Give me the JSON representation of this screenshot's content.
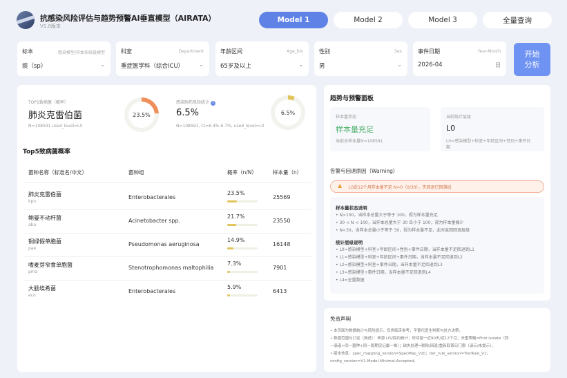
{
  "header": {
    "title": "抗感染风险评估与趋势预警AI垂直模型（AIRATA）",
    "version": "V1.0版本",
    "tabs": [
      {
        "label": "Model 1",
        "active": true
      },
      {
        "label": "Model 2",
        "active": false
      },
      {
        "label": "Model 3",
        "active": false
      },
      {
        "label": "全量查询",
        "active": false
      }
    ]
  },
  "filters": [
    {
      "label": "标本",
      "en": "感染模型/样本系统级模型",
      "value": "痰（sp）",
      "icon": "chevron-down-icon"
    },
    {
      "label": "科室",
      "en": "Department",
      "value": "重症医学科（综合ICU）",
      "icon": "chevron-down-icon"
    },
    {
      "label": "年龄区间",
      "en": "Age_bin",
      "value": "65岁及以上",
      "icon": "chevron-down-icon"
    },
    {
      "label": "性别",
      "en": "Sex",
      "value": "男",
      "icon": "chevron-down-icon"
    },
    {
      "label": "事件日期",
      "en": "Year-Month",
      "value": "2026-04",
      "icon": "calendar-icon"
    }
  ],
  "start_button": {
    "line1": "开始",
    "line2": "分析"
  },
  "left": {
    "top1": {
      "label": "TOP1致病菌（概率）",
      "name": "肺炎克雷伯菌",
      "sub": "N=108591  used_level=L0",
      "ring_value": "23.5%",
      "ring_fraction": 0.235,
      "ring_color": "#ef8f5a"
    },
    "risk": {
      "label": "感染耐药风险统计",
      "value": "6.5%",
      "sub": "N=108591, CI=6.4%-6.7%, used_level=L0",
      "ring_value": "6.5%",
      "ring_fraction": 0.065,
      "ring_color": "#e2c55a"
    },
    "table_title": "Top5致病菌概率",
    "table_headers": [
      "菌种名称（标准名/中文）",
      "菌种组",
      "概率（n/N）",
      "样本量（n）"
    ],
    "rows": [
      {
        "name": "肺炎克雷伯菌",
        "code": "kpn",
        "group": "Enterobacterales",
        "prob": "23.5%",
        "fraction": 0.235,
        "n": "25569"
      },
      {
        "name": "鲍曼不动杆菌",
        "code": "aba",
        "group": "Acinetobacter spp.",
        "prob": "21.7%",
        "fraction": 0.217,
        "n": "23550"
      },
      {
        "name": "铜绿假单胞菌",
        "code": "pae",
        "group": "Pseudomonas aeruginosa",
        "prob": "14.9%",
        "fraction": 0.149,
        "n": "16148"
      },
      {
        "name": "嗜麦芽窄食单胞菌",
        "code": "pma",
        "group": "Stenotrophomonas maltophilia",
        "prob": "7.3%",
        "fraction": 0.073,
        "n": "7901"
      },
      {
        "name": "大肠埃希菌",
        "code": "eco",
        "group": "Enterobacterales",
        "prob": "5.9%",
        "fraction": 0.059,
        "n": "6413"
      }
    ]
  },
  "right": {
    "title": "趋势与预警面板",
    "card1": {
      "label": "样本量状态",
      "value": "样本量充足",
      "sub": "当前总样本量N=108591"
    },
    "card2": {
      "label": "当前统计层级",
      "value": "L0",
      "sub1": "L0=感染模型+科室+年龄区间+性别+事件日",
      "sub2": "期"
    },
    "warning_title": "告警与回退原因（Warning）",
    "warning_text": "L0近12个月样本量不足 N=0（0/30），失回退已回溯线",
    "status_title": "样本量状态说明",
    "status_lines": [
      "• N>100，当样本总量大于等于 100，视为样本量充足",
      "• 30 < N < 100，当样本总量大于 30 且小于 100，视为样本量偏少",
      "• N<30，当样本总量小于等于 30，视为样本量不足，此时返回回退层级"
    ],
    "level_title": "统计层级说明",
    "level_lines": [
      "• L0=感染模型+科室+年龄区间+性别+事件日期，当样本量不足回退到L1",
      "• L1=感染模型+科室+年龄区间+事件日期，当样本量不足回退到L2",
      "• L2=感染模型+科室+事件日期，当样本量不足回退到L3",
      "• L3=感染模型+事件日期，当样本量不足回退到L4",
      "• L4=全量数据"
    ]
  },
  "disclaimer": {
    "title": "免责声明",
    "lines": [
      "• 本页面为数据统计与风险提示，仅供临床参考，不替代医生判断与处方决策。",
      "• 数据范围与口径（简述）：来源 LIS/院内统计；时间窗一近90天/近12个月；去重策略=First isolate（同",
      "  一患者+同一菌种+同一周期仅记最一株）；缺失处理=剔除/回退/重新取首日门限（请示/未提示）。",
      "• 版本信息：spec_mapping_version=SpecMap_V10；tier_rule_version=TierRule_V1；",
      "  config_version=V1-Model-Minimal-Accepted。"
    ]
  }
}
